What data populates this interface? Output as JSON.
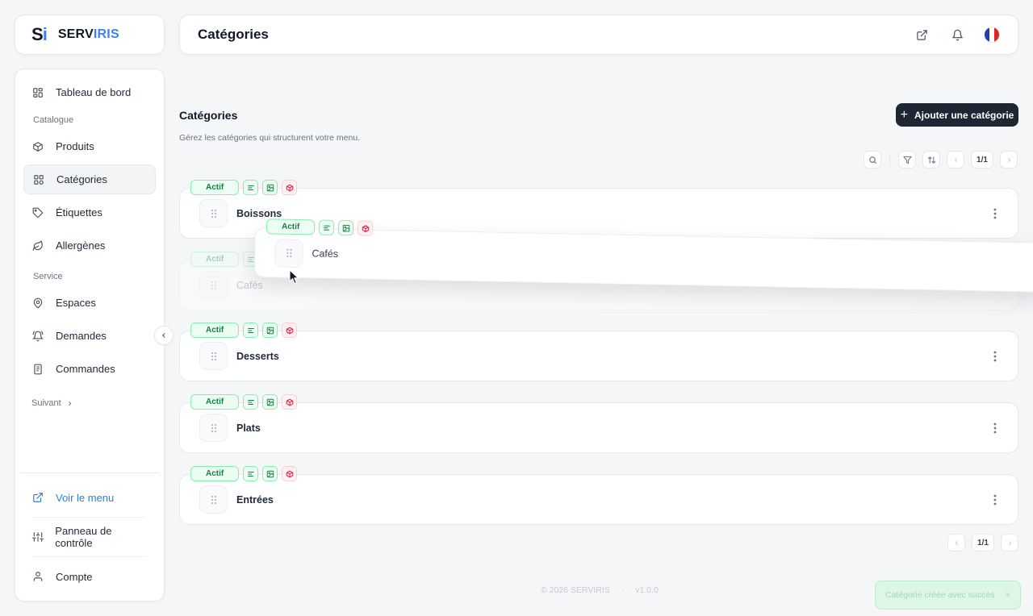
{
  "logo": {
    "mark_s": "S",
    "mark_i": "i",
    "text_a": "SERV",
    "text_b": "IRIS"
  },
  "header": {
    "title": "Catégories"
  },
  "sidebar": {
    "items": [
      {
        "label": "Tableau de bord",
        "icon": "dashboard-icon"
      },
      {
        "section": "Catalogue"
      },
      {
        "label": "Produits",
        "icon": "box-icon"
      },
      {
        "label": "Catégories",
        "icon": "grid-icon",
        "active": true
      },
      {
        "label": "Étiquettes",
        "icon": "tag-icon"
      },
      {
        "label": "Allergènes",
        "icon": "leaf-icon"
      },
      {
        "section": "Service"
      },
      {
        "label": "Espaces",
        "icon": "map-pin-icon"
      },
      {
        "label": "Demandes",
        "icon": "bell-icon"
      },
      {
        "label": "Commandes",
        "icon": "receipt-icon"
      }
    ],
    "next_label": "Suivant",
    "bottom": {
      "view_menu": "Voir le menu",
      "control_panel": "Panneau de contrôle",
      "account": "Compte"
    }
  },
  "main": {
    "title": "Catégories",
    "subtitle": "Gérez les catégories qui structurent votre menu.",
    "add_button": "Ajouter une catégorie",
    "page_indicator": "1/1",
    "badge_label": "Actif",
    "categories": [
      "Boissons",
      "Cafés",
      "Desserts",
      "Plats",
      "Entrées"
    ],
    "dragging": "Cafés"
  },
  "footer": {
    "copyright": "© 2026 SERVIRIS",
    "separator": "·",
    "version": "v1.0.0"
  },
  "toast": {
    "message": "Catégorie créée avec succès",
    "close": "×"
  },
  "colors": {
    "primary_button": "#1e2533",
    "active_badge": "#15803d",
    "link": "#2f7fd1",
    "accent": "#3b82f6"
  }
}
